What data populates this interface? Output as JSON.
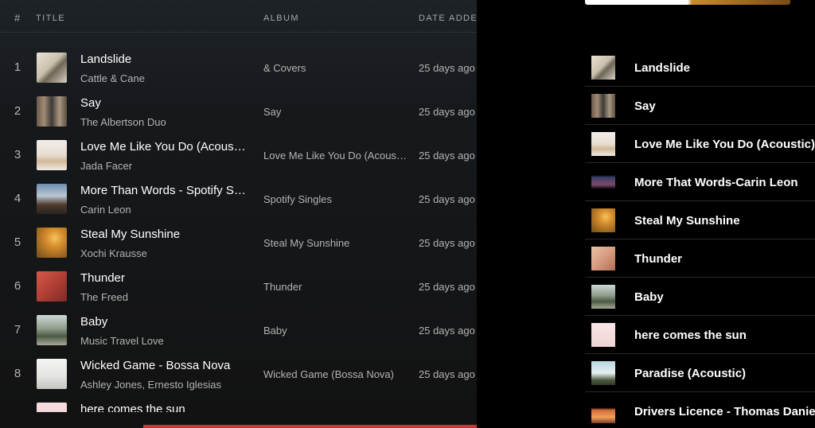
{
  "table_header": {
    "num": "#",
    "title": "TITLE",
    "album": "ALBUM",
    "date_added": "DATE ADDE"
  },
  "tracks": [
    {
      "num": "1",
      "title": "Landslide",
      "artist": "Cattle & Cane",
      "album": "& Covers",
      "date": "25 days ago",
      "art": "landslide"
    },
    {
      "num": "2",
      "title": "Say",
      "artist": "The Albertson Duo",
      "album": "Say",
      "date": "25 days ago",
      "art": "say"
    },
    {
      "num": "3",
      "title": "Love Me Like You Do (Acoustic)",
      "artist": "Jada Facer",
      "album": "Love Me Like You Do (Acoustic)",
      "date": "25 days ago",
      "art": "love"
    },
    {
      "num": "4",
      "title": "More Than Words - Spotify Singles",
      "artist": "Carin Leon",
      "album": "Spotify Singles",
      "date": "25 days ago",
      "art": "more"
    },
    {
      "num": "5",
      "title": "Steal My Sunshine",
      "artist": "Xochi Krausse",
      "album": "Steal My Sunshine",
      "date": "25 days ago",
      "art": "steal"
    },
    {
      "num": "6",
      "title": "Thunder",
      "artist": "The Freed",
      "album": "Thunder",
      "date": "25 days ago",
      "art": "thunder"
    },
    {
      "num": "7",
      "title": "Baby",
      "artist": "Music Travel Love",
      "album": "Baby",
      "date": "25 days ago",
      "art": "baby"
    },
    {
      "num": "8",
      "title": "Wicked Game - Bossa Nova",
      "artist": "Ashley Jones, Ernesto Iglesias",
      "album": "Wicked Game (Bossa Nova)",
      "date": "25 days ago",
      "art": "wicked"
    },
    {
      "num": "9",
      "title": "here comes the sun",
      "artist": "",
      "album": "",
      "date": "",
      "art": "sun"
    }
  ],
  "queue": [
    {
      "title": "Landslide",
      "art": "landslide"
    },
    {
      "title": "Say",
      "art": "say"
    },
    {
      "title": "Love Me Like You Do (Acoustic)",
      "art": "love"
    },
    {
      "title": "More That Words-Carin Leon",
      "art": "more-q"
    },
    {
      "title": "Steal My Sunshine",
      "art": "steal"
    },
    {
      "title": "Thunder",
      "art": "thunder-q"
    },
    {
      "title": "Baby",
      "art": "baby"
    },
    {
      "title": "here comes the sun",
      "art": "sun-q"
    },
    {
      "title": "Paradise (Acoustic)",
      "art": "paradise"
    },
    {
      "title": "Drivers Licence - Thomas Daniel",
      "art": "drivers"
    }
  ]
}
